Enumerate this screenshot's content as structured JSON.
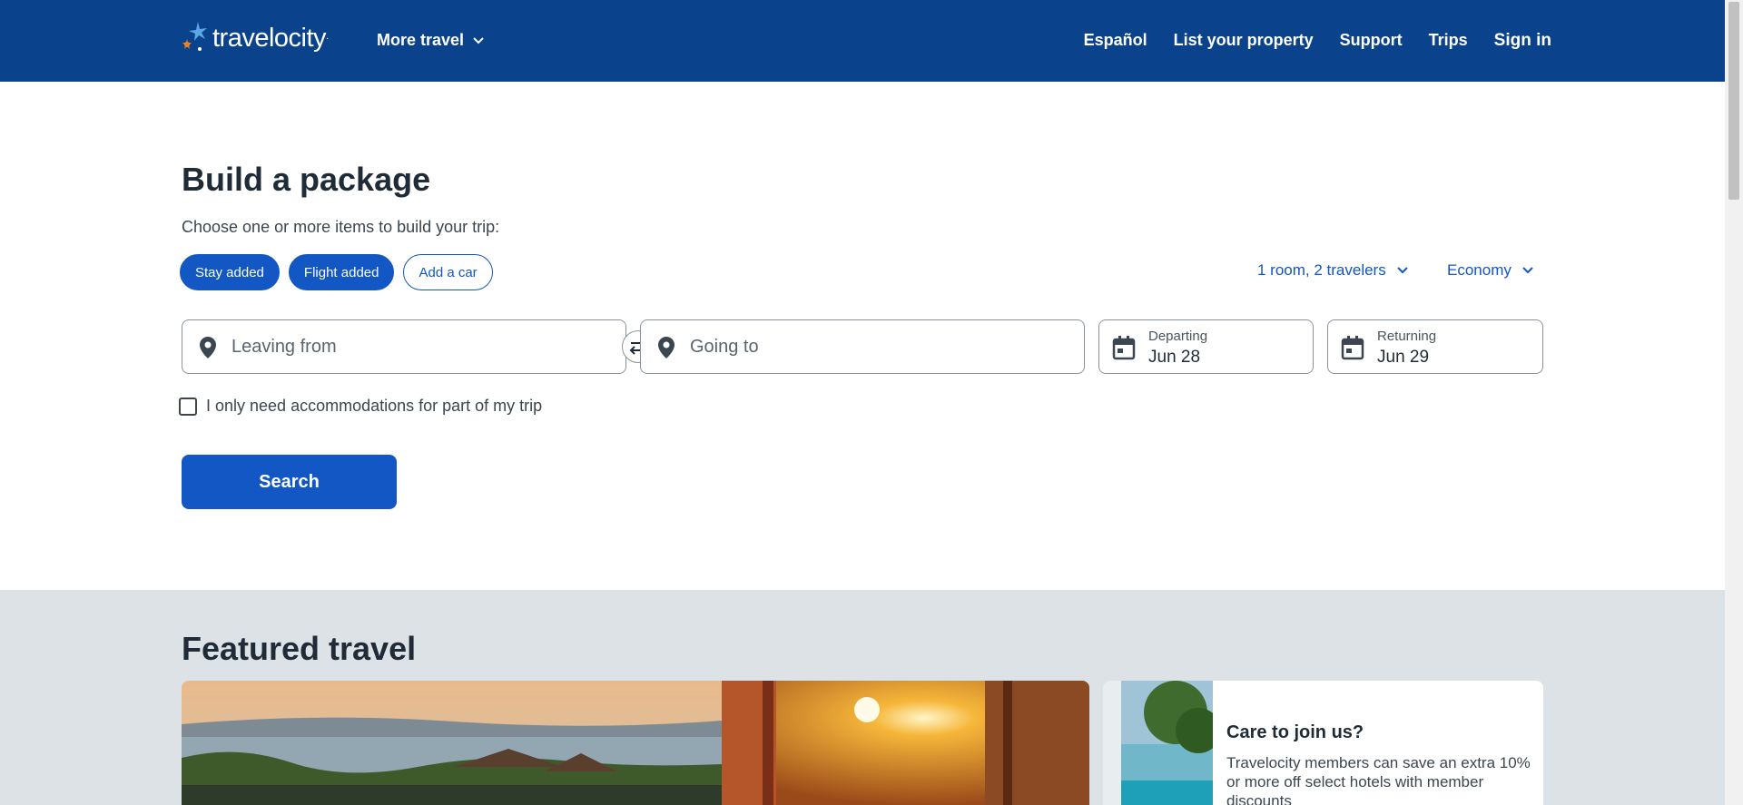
{
  "header": {
    "logo_text": "travelocity",
    "logo_suffix": "·",
    "more_travel": "More travel",
    "nav": {
      "language": "Español",
      "list_property": "List your property",
      "support": "Support",
      "trips": "Trips",
      "sign_in": "Sign in"
    },
    "colors": {
      "background": "#0a438b"
    }
  },
  "search": {
    "title": "Build a package",
    "subtitle": "Choose one or more items to build your trip:",
    "chips": {
      "stay": "Stay added",
      "flight": "Flight added",
      "car": "Add a car"
    },
    "travelers": "1 room, 2 travelers",
    "cabin_class": "Economy",
    "leaving_from": {
      "placeholder": "Leaving from",
      "icon": "location-pin-icon"
    },
    "going_to": {
      "placeholder": "Going to",
      "icon": "location-pin-icon"
    },
    "departing": {
      "label": "Departing",
      "value": "Jun 28"
    },
    "returning": {
      "label": "Returning",
      "value": "Jun 29"
    },
    "partial_stay_label": "I only need accommodations for part of my trip",
    "partial_stay_checked": false,
    "search_button": "Search",
    "colors": {
      "accent": "#1257c3"
    }
  },
  "featured": {
    "title": "Featured travel",
    "promo": {
      "title": "Care to join us?",
      "text": "Travelocity members can save an extra 10% or more off select hotels with member discounts"
    }
  }
}
